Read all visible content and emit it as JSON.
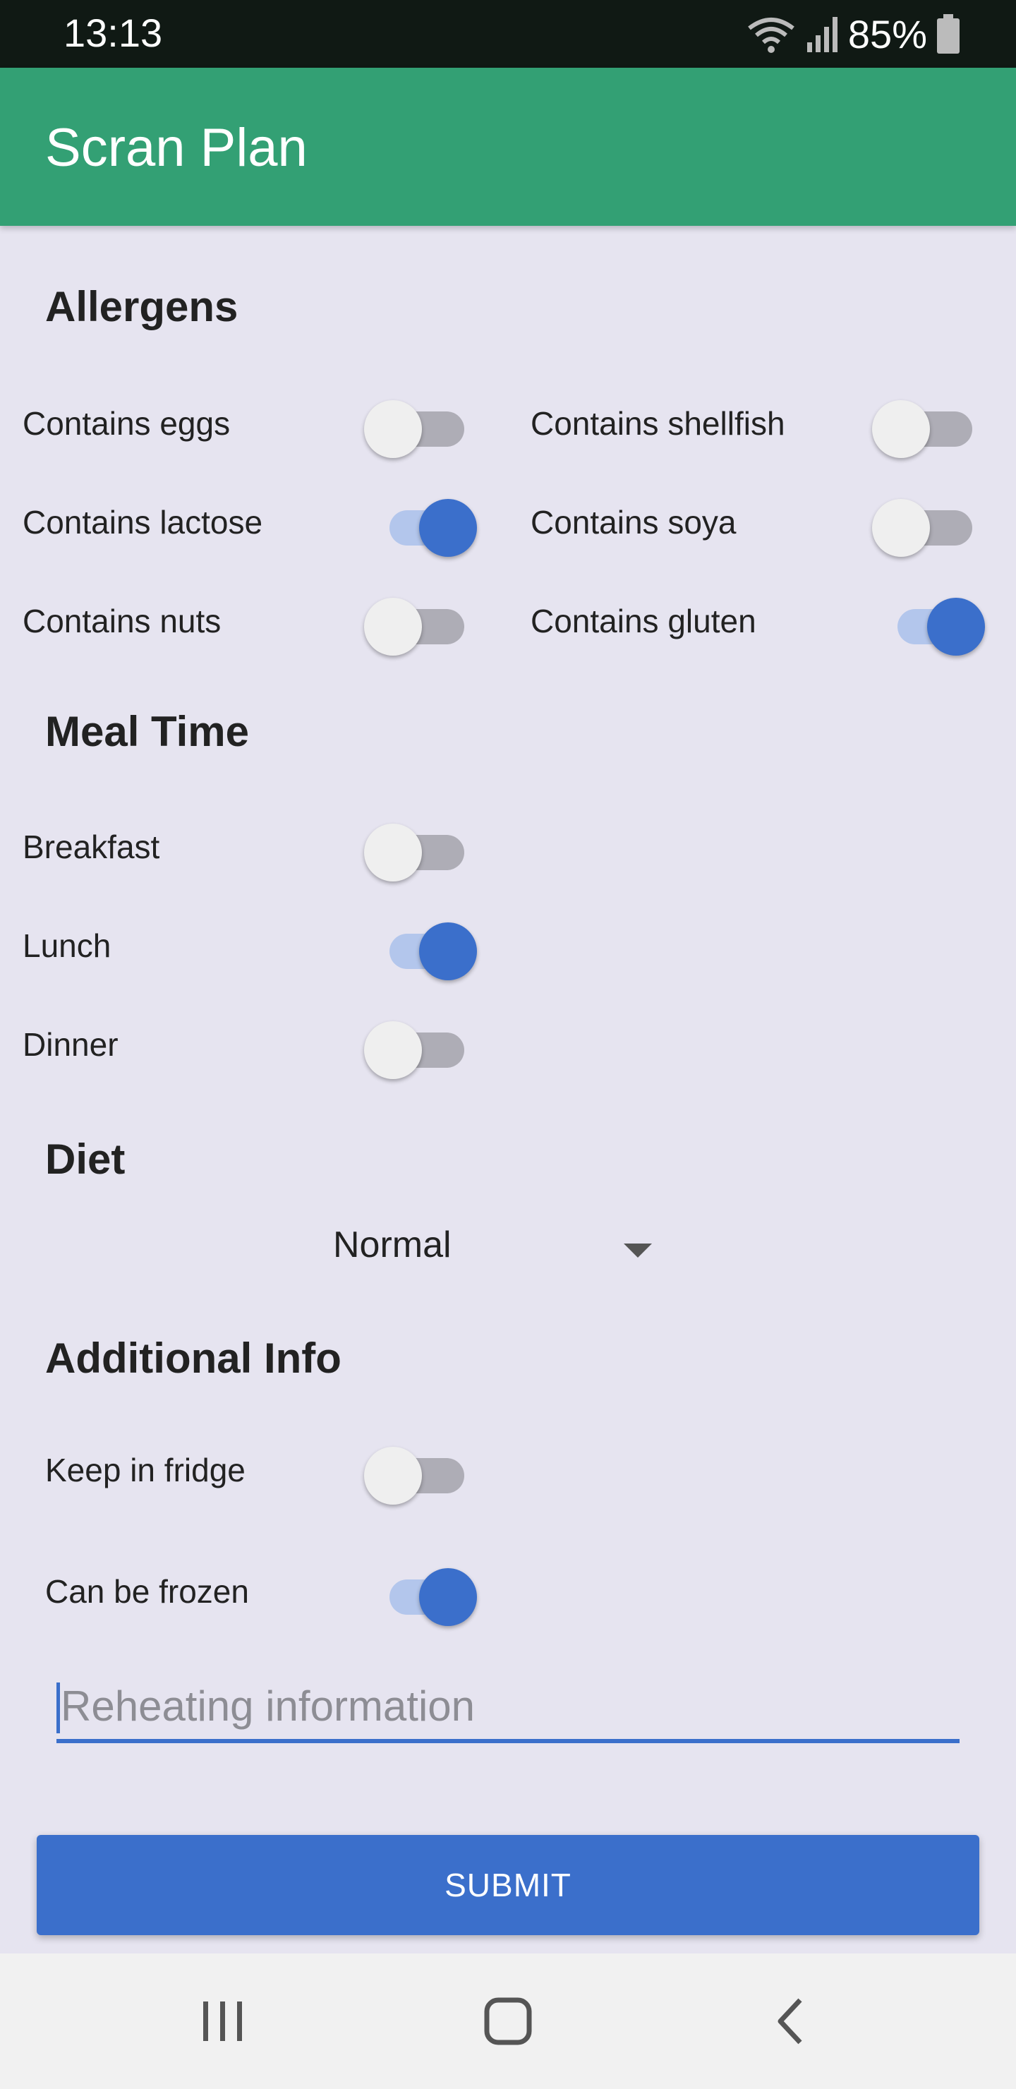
{
  "status": {
    "time": "13:13",
    "battery": "85%"
  },
  "app": {
    "title": "Scran Plan"
  },
  "allergens": {
    "title": "Allergens",
    "items": [
      {
        "label": "Contains eggs",
        "on": false
      },
      {
        "label": "Contains shellfish",
        "on": false
      },
      {
        "label": "Contains lactose",
        "on": true
      },
      {
        "label": "Contains soya",
        "on": false
      },
      {
        "label": "Contains nuts",
        "on": false
      },
      {
        "label": "Contains gluten",
        "on": true
      }
    ]
  },
  "meal_time": {
    "title": "Meal Time",
    "items": [
      {
        "label": "Breakfast",
        "on": false
      },
      {
        "label": "Lunch",
        "on": true
      },
      {
        "label": "Dinner",
        "on": false
      }
    ]
  },
  "diet": {
    "title": "Diet",
    "selected": "Normal"
  },
  "additional": {
    "title": "Additional Info",
    "items": [
      {
        "label": "Keep in fridge",
        "on": false
      },
      {
        "label": "Can be frozen",
        "on": true
      }
    ],
    "reheat_placeholder": "Reheating information",
    "reheat_value": ""
  },
  "submit": {
    "label": "SUBMIT"
  },
  "colors": {
    "app_bar": "#33a074",
    "accent": "#3b6fcb",
    "background": "#e6e4f0"
  },
  "icons": {
    "wifi": "wifi-icon",
    "signal": "signal-icon",
    "battery": "battery-icon",
    "recents": "recents-icon",
    "home": "home-icon",
    "back": "back-icon",
    "dropdown": "dropdown-arrow-icon"
  }
}
